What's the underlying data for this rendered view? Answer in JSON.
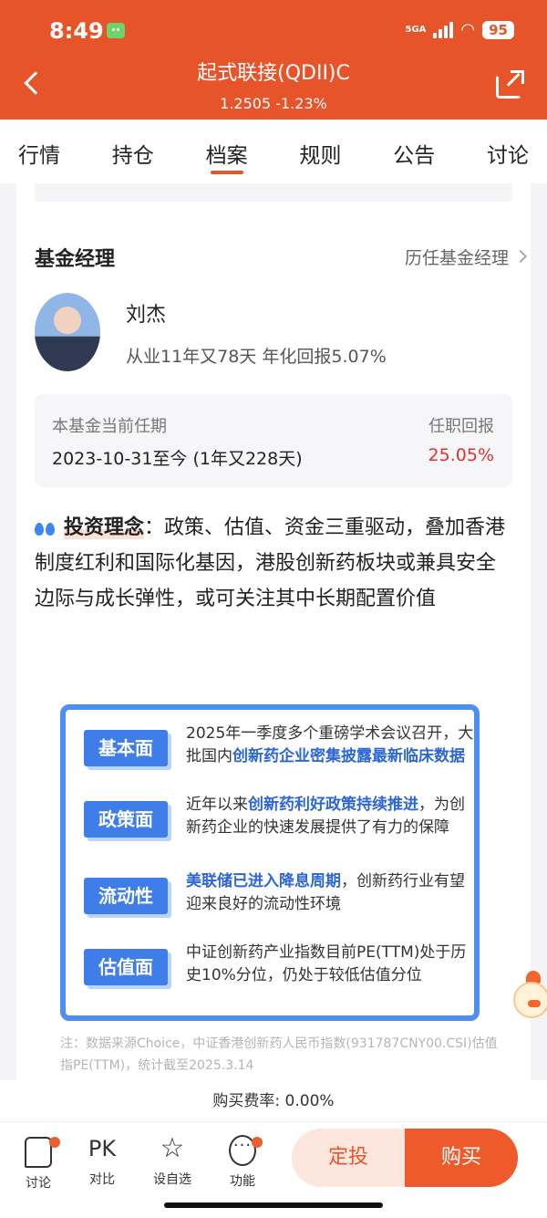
{
  "status": {
    "time": "8:49",
    "network": "5GA",
    "battery": "95"
  },
  "header": {
    "title": "起式联接(QDII)C",
    "price_change": "1.2505 -1.23%"
  },
  "tabs": [
    "行情",
    "持仓",
    "档案",
    "规则",
    "公告",
    "讨论"
  ],
  "active_tab": "档案",
  "manager_section": {
    "title": "基金经理",
    "history_link": "历任基金经理",
    "name": "刘杰",
    "experience": "从业11年又78天 年化回报5.07%",
    "tenure_label": "本基金当前任期",
    "tenure_period": "2023-10-31至今 (1年又228天)",
    "return_label": "任职回报",
    "return_value": "25.05%"
  },
  "philosophy": {
    "label": "投资理念",
    "text": "：政策、估值、资金三重驱动，叠加香港制度红利和国际化基因，港股创新药板块或兼具安全边际与成长弹性，或可关注其中长期配置价值"
  },
  "infographic": {
    "rows": [
      {
        "tag": "基本面",
        "pre": "2025年一季度多个重磅学术会议召开，大批国内",
        "hl": "创新药企业密集披露最新临床数据",
        "post": ""
      },
      {
        "tag": "政策面",
        "pre": "近年以来",
        "hl": "创新药利好政策持续推进",
        "post": "，为创新药企业的快速发展提供了有力的保障"
      },
      {
        "tag": "流动性",
        "pre": "",
        "hl": "美联储已进入降息周期",
        "post": "，创新药行业有望迎来良好的流动性环境"
      },
      {
        "tag": "估值面",
        "pre": "中证创新药产业指数目前PE(TTM)处于历史10%分位，仍处于较低估值分位",
        "hl": "",
        "post": ""
      }
    ],
    "note": "注：数据来源Choice，中证香港创新药人民币指数(931787CNY00.CSI)估值指PE(TTM)，统计截至2025.3.14"
  },
  "fee": "购买费率: 0.00%",
  "bottom_nav": [
    {
      "label": "讨论",
      "icon": "chat-icon"
    },
    {
      "label": "对比",
      "icon": "pk-icon"
    },
    {
      "label": "设自选",
      "icon": "star-icon"
    },
    {
      "label": "功能",
      "icon": "more-icon"
    }
  ],
  "actions": {
    "invest": "定投",
    "buy": "购买"
  },
  "colors": {
    "brand": "#e8542a",
    "return": "#e0332d",
    "info_blue": "#3f7ee8"
  }
}
